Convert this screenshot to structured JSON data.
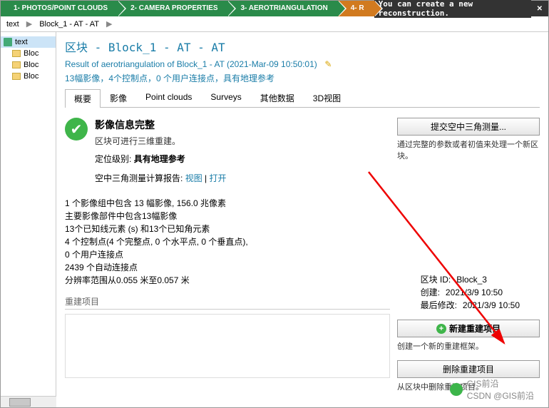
{
  "steps": {
    "s1": "1- PHOTOS/POINT CLOUDS",
    "s2": "2- CAMERA PROPERTIES",
    "s3": "3- AEROTRIANGULATION",
    "s4": "4- R"
  },
  "tip": "You can create a new reconstruction.",
  "close": "✕",
  "breadcrumb": {
    "b1": "text",
    "b2": "Block_1 - AT - AT"
  },
  "tree": {
    "root": "text",
    "c1": "Bloc",
    "c2": "Bloc",
    "c3": "Bloc"
  },
  "header": {
    "title": "区块 - Block_1 - AT - AT",
    "sub": "Result of aerotriangulation of Block_1 - AT (2021-Mar-09 10:50:01)",
    "sub2": "13幅影像，4个控制点，0 个用户连接点，具有地理参考"
  },
  "tabs": {
    "t1": "概要",
    "t2": "影像",
    "t3": "Point clouds",
    "t4": "Surveys",
    "t5": "其他数据",
    "t6": "3D视图"
  },
  "status": {
    "heading": "影像信息完整",
    "desc": "区块可进行三维重建。",
    "levelLabel": "定位级别:",
    "levelValue": "具有地理参考",
    "reportLabel": "空中三角测量计算报告:",
    "view": "视图",
    "open": "打开"
  },
  "stats": {
    "l1": "1 个影像组中包含 13 幅影像, 156.0 兆像素",
    "l2": "主要影像部件中包含13幅影像",
    "l3": "13个已知线元素 (s) 和13个已知角元素",
    "l4": "4 个控制点(4 个完整点, 0 个水平点, 0 个垂直点),",
    "l5": "0 个用户连接点",
    "l6": "2439 个自动连接点",
    "l7": "分辨率范围从0.055 米至0.057 米"
  },
  "meta": {
    "idLabel": "区块 ID:",
    "idVal": "Block_3",
    "createdLabel": "创建:",
    "createdVal": "2021/3/9 10:50",
    "modLabel": "最后修改:",
    "modVal": "2021/3/9 10:50"
  },
  "sections": {
    "rebuild": "重建项目"
  },
  "right": {
    "btn1": "提交空中三角测量...",
    "desc1": "通过完整的参数或者初值来处理一个新区块。",
    "btn2": "新建重建项目",
    "desc2": "创建一个新的重建框架。",
    "btn3": "删除重建项目",
    "desc3": "从区块中删除重建项目。"
  },
  "watermark": {
    "l1": "GIS前沿",
    "l2": "CSDN @GIS前沿"
  }
}
